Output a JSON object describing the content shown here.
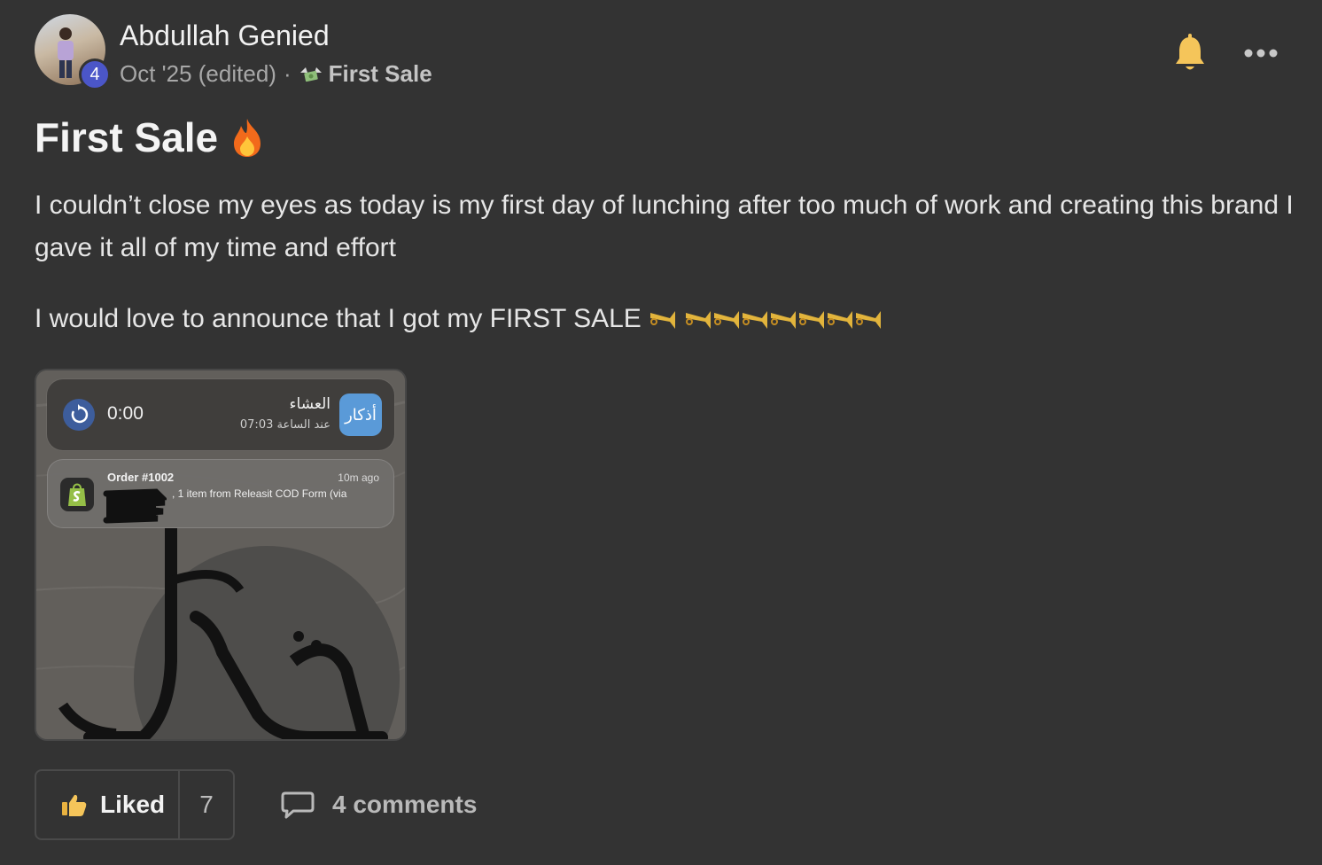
{
  "post": {
    "author": "Abdullah Genied",
    "level": "4",
    "date": "Oct '25 (edited)",
    "separator": "·",
    "category": "First Sale",
    "category_icon": "money-with-wings-icon",
    "title": "First Sale",
    "title_emoji": "fire-icon",
    "paragraph1": "I couldn’t close my eyes as today is my first day of lunching after too much of work and creating this brand I gave it all of my time and effort",
    "paragraph2": "I would love to announce that I got my FIRST SALE"
  },
  "attachment": {
    "timer": "0:00",
    "prayer_name": "العشاء",
    "prayer_time": "عند الساعة 07:03",
    "app_name": "أذكار",
    "order_title": "Order #1002",
    "order_time": "10m ago",
    "order_body": ", 1 item from Releasit COD Form (via"
  },
  "actions": {
    "like_label": "Liked",
    "like_count": "7",
    "comments_label": "4 comments"
  },
  "colors": {
    "background": "#333333",
    "badge": "#4b56c8",
    "bell": "#f5c55a"
  }
}
